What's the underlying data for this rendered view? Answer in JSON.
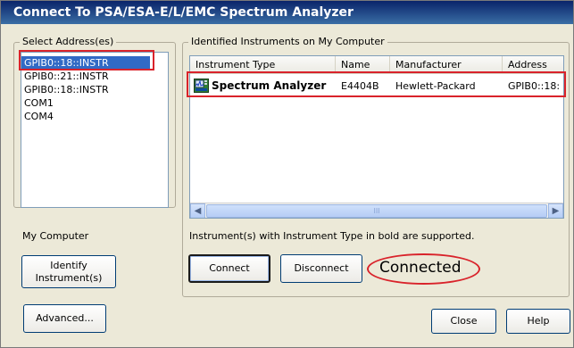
{
  "window": {
    "title": "Connect To PSA/ESA-E/L/EMC Spectrum Analyzer"
  },
  "left_panel": {
    "group_label": "Select Address(es)",
    "addresses": [
      {
        "label": "GPIB0::18::INSTR",
        "selected": true
      },
      {
        "label": "GPIB0::21::INSTR",
        "selected": false
      },
      {
        "label": "GPIB0::18::INSTR",
        "selected": false
      },
      {
        "label": "COM1",
        "selected": false
      },
      {
        "label": "COM4",
        "selected": false
      }
    ],
    "my_computer_label": "My Computer",
    "identify_button": "Identify\nInstrument(s)"
  },
  "right_panel": {
    "group_label": "Identified Instruments on My Computer",
    "columns": [
      "Instrument Type",
      "Name",
      "Manufacturer",
      "Address"
    ],
    "rows": [
      {
        "type": "Spectrum Analyzer",
        "name": "E4404B",
        "manufacturer": "Hewlett-Packard",
        "address": "GPIB0::18:"
      }
    ],
    "scroll_thumb_grip": "III",
    "note": "Instrument(s) with Instrument Type in bold are supported.",
    "connect_button": "Connect",
    "disconnect_button": "Disconnect",
    "status": "Connected"
  },
  "footer": {
    "advanced_button": "Advanced...",
    "close_button": "Close",
    "help_button": "Help"
  },
  "colors": {
    "selection": "#316ac5",
    "highlight_annotation": "#d9232b",
    "title_bar": "#0a246a"
  }
}
